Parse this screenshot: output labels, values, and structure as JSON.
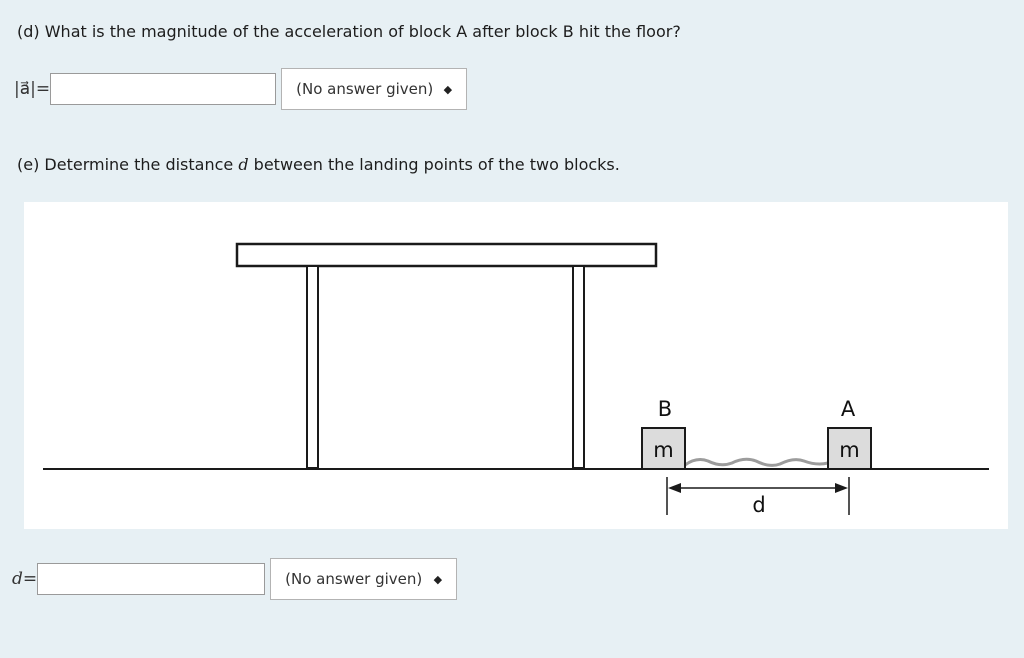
{
  "question_d": {
    "text": "(d) What is the magnitude of the acceleration of block A after block B hit the floor?"
  },
  "answer_a": {
    "label": "|a⃗|=",
    "value": "",
    "unit_selected": "(No answer given)"
  },
  "question_e": {
    "text_before": "(e) Determine the distance ",
    "variable": "d",
    "text_after": " between the landing points of the two blocks."
  },
  "figure": {
    "block_b_label": "B",
    "block_a_label": "A",
    "block_b_mass": "m",
    "block_a_mass": "m",
    "distance_label": "d"
  },
  "answer_d": {
    "label": "d=",
    "value": "",
    "unit_selected": "(No answer given)"
  },
  "colors": {
    "background": "#e7f0f4",
    "block_fill": "#dcdcdc",
    "string": "#a0a0a0"
  },
  "icons": [
    "select-arrows-icon"
  ]
}
